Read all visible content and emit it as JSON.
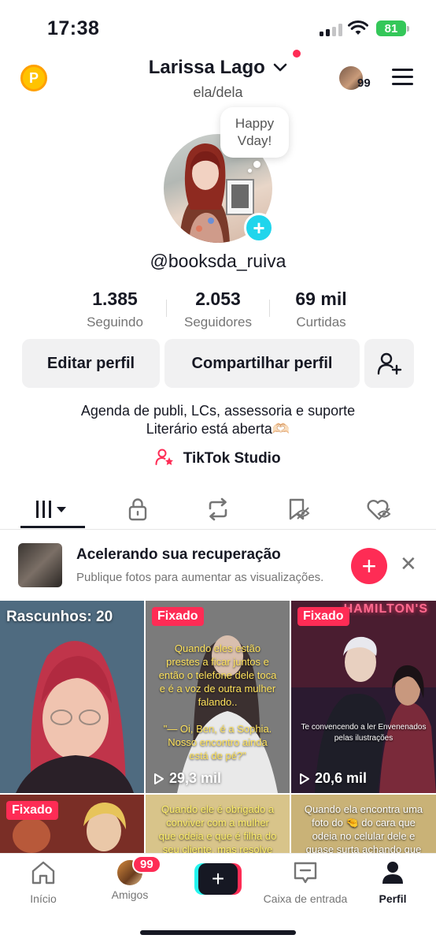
{
  "status_bar": {
    "time": "17:38",
    "battery": "81"
  },
  "header": {
    "coin_label": "P",
    "name": "Larissa Lago",
    "pronouns": "ela/dela",
    "visitors_count": "99"
  },
  "profile": {
    "bubble_text": "Happy Vday!",
    "handle": "@booksda_ruiva",
    "stats": [
      {
        "value": "1.385",
        "label": "Seguindo"
      },
      {
        "value": "2.053",
        "label": "Seguidores"
      },
      {
        "value": "69 mil",
        "label": "Curtidas"
      }
    ],
    "buttons": {
      "edit": "Editar perfil",
      "share": "Compartilhar perfil"
    },
    "bio_line1": "Agenda de publi, LCs, assessoria e suporte",
    "bio_line2": "Literário está aberta🫶🏻",
    "studio_label": "TikTok Studio"
  },
  "tabs": [
    "videos-grid",
    "private",
    "reposts",
    "favorites",
    "liked"
  ],
  "banner": {
    "title": "Acelerando sua recuperação",
    "subtitle": "Publique fotos para aumentar as visualizações."
  },
  "grid": {
    "drafts_label": "Rascunhos: 20",
    "pinned_label": "Fixado",
    "items": [
      {
        "views": "29,3 mil",
        "caption": "Quando eles estão prestes a ficar juntos e então o telefone dele toca e é a voz de outra mulher falando..\n\n\"— Oi, Ben, é a Sophia. Nosso encontro ainda está de pé?\""
      },
      {
        "views": "20,6 mil",
        "caption": "Te convencendo a ler Envenenados pelas ilustrações",
        "sign": "HAMILTON'S"
      },
      {
        "caption": "Quando ele é obrigado a conviver com a mulher que odeia e que é filha do seu cliente, mas resolve"
      },
      {
        "caption": "Quando ela encontra uma foto do 🤏 do cara que odeia no celular dele e quase surta achando que"
      }
    ]
  },
  "bottom_nav": {
    "home": "Início",
    "friends": "Amigos",
    "friends_badge": "99",
    "inbox": "Caixa de entrada",
    "profile": "Perfil"
  }
}
